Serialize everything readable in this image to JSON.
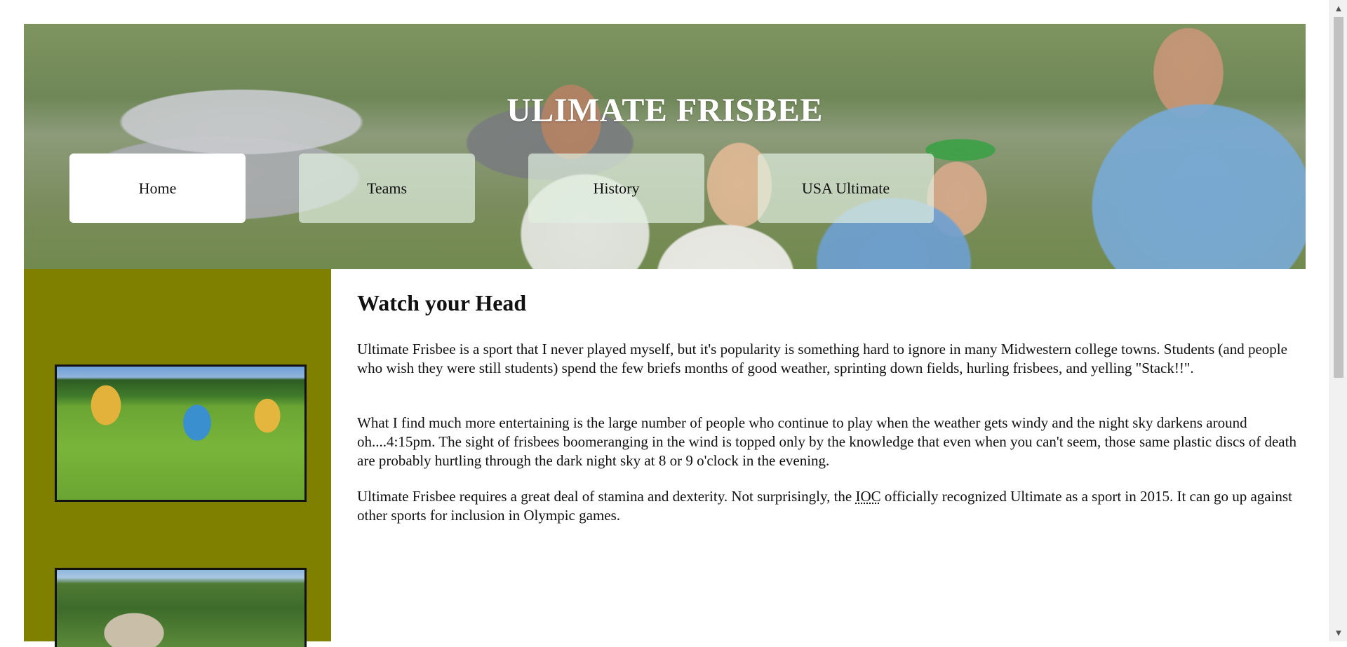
{
  "header": {
    "title": "ULIMATE FRISBEE"
  },
  "nav": {
    "items": [
      {
        "label": "Home",
        "active": true
      },
      {
        "label": "Teams",
        "active": false
      },
      {
        "label": "History",
        "active": false
      },
      {
        "label": "USA Ultimate",
        "active": false
      }
    ]
  },
  "main": {
    "heading": "Watch your Head",
    "para1": "Ultimate Frisbee is a sport that I never played myself, but it's popularity is something hard to ignore in many Midwestern college towns. Students (and people who wish they were still students) spend the few briefs months of good weather, sprinting down fields, hurling frisbees, and yelling \"Stack!!\".",
    "para2": "What I find much more entertaining is the large number of people who continue to play when the weather gets windy and the night sky darkens around oh....4:15pm. The sight of frisbees boomeranging in the wind is topped only by the knowledge that even when you can't seem, those same plastic discs of death are probably hurtling through the dark night sky at 8 or 9 o'clock in the evening.",
    "para3_before": "Ultimate Frisbee requires a great deal of stamina and dexterity. Not surprisingly, the ",
    "para3_abbr": "IOC",
    "para3_after": " officially recognized Ultimate as a sport in 2015. It can go up against other sports for inclusion in Olympic games."
  },
  "colors": {
    "sidebar": "#808000",
    "nav_active": "#ffffff",
    "title": "#ffffff"
  }
}
